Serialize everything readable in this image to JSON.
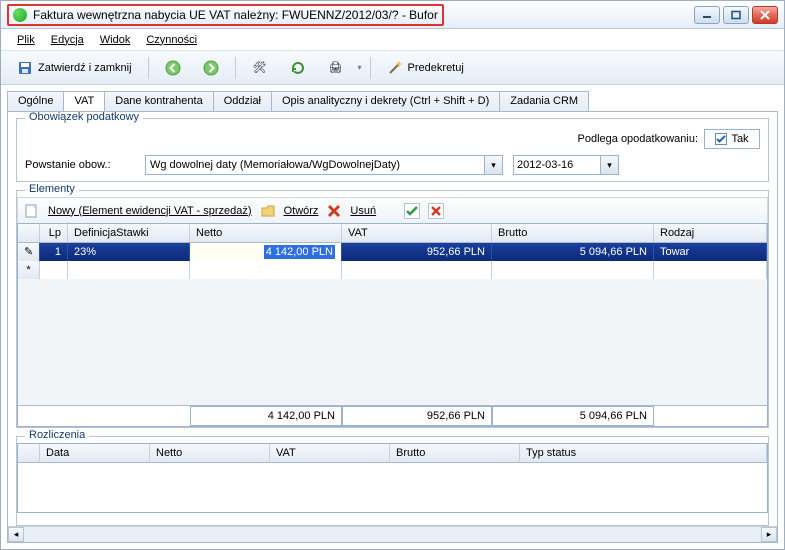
{
  "window": {
    "title": "Faktura wewnętrzna nabycia UE VAT należny: FWUENNZ/2012/03/? - Bufor"
  },
  "menubar": {
    "plik": "Plik",
    "edycja": "Edycja",
    "widok": "Widok",
    "czynnosci": "Czynności"
  },
  "toolbar": {
    "save_close_label": "Zatwierdź i zamknij",
    "predecree_label": "Predekretuj"
  },
  "tabs": {
    "ogolne": "Ogólne",
    "vat": "VAT",
    "dane": "Dane kontrahenta",
    "oddzial": "Oddział",
    "opis": "Opis analityczny i dekrety (Ctrl + Shift + D)",
    "zadania": "Zadania CRM"
  },
  "tax_duty": {
    "legend": "Obowiązek podatkowy",
    "subject_label": "Podlega opodatkowaniu:",
    "subject_value": "Tak",
    "origin_label": "Powstanie obow.:",
    "origin_select": "Wg dowolnej daty (Memoriałowa/WgDowolnejDaty)",
    "date": "2012-03-16"
  },
  "elements": {
    "legend": "Elementy",
    "new_label": "Nowy (Element ewidencji VAT - sprzedaż)",
    "open_label": "Otwórz",
    "delete_label": "Usuń",
    "columns": {
      "lp": "Lp",
      "def": "DefinicjaStawki",
      "netto": "Netto",
      "vat": "VAT",
      "brutto": "Brutto",
      "rodzaj": "Rodzaj"
    },
    "rows": [
      {
        "lp": "1",
        "def": "23%",
        "netto": "4 142,00 PLN",
        "vat": "952,66 PLN",
        "brutto": "5 094,66 PLN",
        "rodzaj": "Towar"
      }
    ],
    "footer": {
      "netto": "4 142,00 PLN",
      "vat": "952,66 PLN",
      "brutto": "5 094,66 PLN"
    }
  },
  "settlements": {
    "legend": "Rozliczenia",
    "columns": {
      "data": "Data",
      "netto": "Netto",
      "vat": "VAT",
      "brutto": "Brutto",
      "typ": "Typ status"
    }
  }
}
